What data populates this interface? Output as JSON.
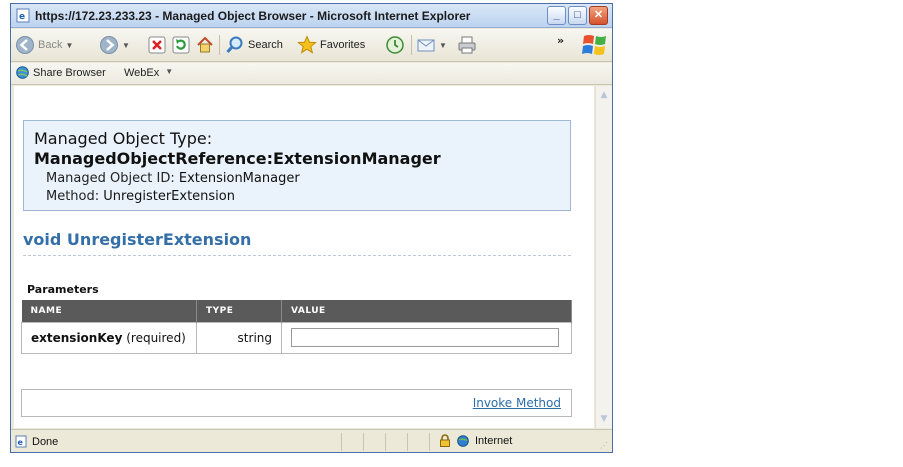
{
  "window": {
    "title": "https://172.23.233.23 - Managed Object Browser - Microsoft Internet Explorer",
    "controls": [
      "minimize",
      "maximize",
      "close"
    ]
  },
  "toolbar": {
    "back_label": "Back",
    "search_label": "Search",
    "favorites_label": "Favorites",
    "more_label": "»"
  },
  "links_bar": {
    "share_browser": "Share Browser",
    "webex": "WebEx"
  },
  "page": {
    "object_type_label": "Managed Object Type:",
    "object_reference": "ManagedObjectReference:ExtensionManager",
    "object_id_label": "Managed Object ID:",
    "object_id": "ExtensionManager",
    "method_label": "Method:",
    "method_name": "UnregisterExtension",
    "method_signature": "void UnregisterExtension",
    "parameters_heading": "Parameters",
    "table": {
      "columns": [
        "NAME",
        "TYPE",
        "VALUE"
      ],
      "rows": [
        {
          "name": "extensionKey",
          "qualifier": "(required)",
          "type": "string",
          "value": ""
        }
      ]
    },
    "invoke_label": "Invoke Method"
  },
  "status": {
    "text": "Done",
    "zone": "Internet"
  }
}
